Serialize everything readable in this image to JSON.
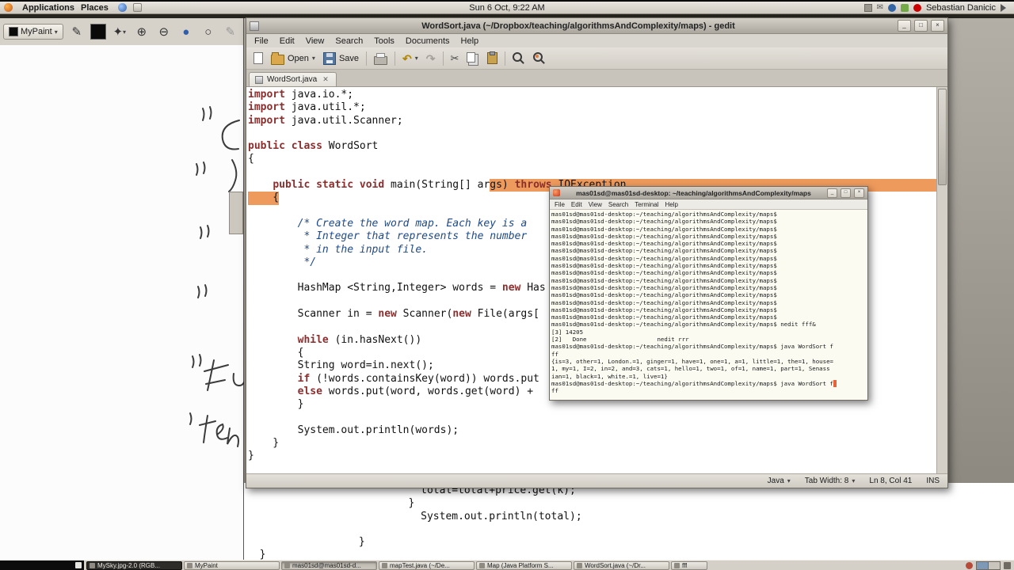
{
  "icons": {
    "caret": "▾",
    "close": "×",
    "min": "_",
    "max": "□",
    "tab_close": "✕",
    "scissors": "✂",
    "undo": "↶",
    "redo": "↷",
    "pencil": "✎",
    "star": "✦",
    "zoom_in": "⊕",
    "zoom_out": "⊖",
    "dot": "●",
    "ring": "○",
    "mail": "✉"
  },
  "top_panel": {
    "menus": [
      "Applications",
      "Places"
    ],
    "clock": "Sun 6 Oct, 9:22 AM",
    "user": "Sebastian Danicic"
  },
  "mypaint": {
    "app_label": "MyPaint"
  },
  "gedit": {
    "title": "WordSort.java (~/Dropbox/teaching/algorithmsAndComplexity/maps) - gedit",
    "menu": [
      "File",
      "Edit",
      "View",
      "Search",
      "Tools",
      "Documents",
      "Help"
    ],
    "toolbar": {
      "open": "Open",
      "save": "Save"
    },
    "tab": "WordSort.java",
    "status": {
      "language": "Java",
      "tab_width": "Tab Width: 8",
      "cursor": "Ln 8, Col 41",
      "mode": "INS"
    },
    "code_lines": [
      {
        "s": [
          [
            "k",
            "import"
          ],
          [
            "p",
            " java.io.*;"
          ]
        ]
      },
      {
        "s": [
          [
            "k",
            "import"
          ],
          [
            "p",
            " java.util.*;"
          ]
        ]
      },
      {
        "s": [
          [
            "k",
            "import"
          ],
          [
            "p",
            " java.util.Scanner;"
          ]
        ]
      },
      {},
      {
        "s": [
          [
            "k",
            "public"
          ],
          [
            "p",
            " "
          ],
          [
            "k",
            "class"
          ],
          [
            "p",
            " WordSort"
          ]
        ]
      },
      {
        "s": [
          [
            "p",
            "{"
          ]
        ]
      },
      {},
      {
        "s": [
          [
            "p",
            "    "
          ],
          [
            "k",
            "public"
          ],
          [
            "p",
            " "
          ],
          [
            "k",
            "static"
          ],
          [
            "p",
            " "
          ],
          [
            "k",
            "void"
          ],
          [
            "p",
            " main(String[] ar"
          ],
          [
            "p sel",
            "gs) "
          ],
          [
            "k sel",
            "throws"
          ],
          [
            "p sel",
            " IOException"
          ]
        ],
        "ext": true
      },
      {
        "s": [
          [
            "p sel",
            "    {"
          ]
        ]
      },
      {},
      {
        "s": [
          [
            "c",
            "        /* Create the word map. Each key is a"
          ]
        ]
      },
      {
        "s": [
          [
            "c",
            "         * Integer that represents the number"
          ]
        ]
      },
      {
        "s": [
          [
            "c",
            "         * in the input file."
          ]
        ]
      },
      {
        "s": [
          [
            "c",
            "         */"
          ]
        ]
      },
      {},
      {
        "s": [
          [
            "p",
            "        HashMap <String,Integer> words = "
          ],
          [
            "k",
            "new"
          ],
          [
            "p",
            " Has"
          ]
        ]
      },
      {},
      {
        "s": [
          [
            "p",
            "        Scanner in = "
          ],
          [
            "k",
            "new"
          ],
          [
            "p",
            " Scanner("
          ],
          [
            "k",
            "new"
          ],
          [
            "p",
            " File(args["
          ]
        ]
      },
      {},
      {
        "s": [
          [
            "p",
            "        "
          ],
          [
            "k",
            "while"
          ],
          [
            "p",
            " (in.hasNext())"
          ]
        ]
      },
      {
        "s": [
          [
            "p",
            "        {"
          ]
        ]
      },
      {
        "s": [
          [
            "p",
            "        String word=in.next();"
          ]
        ]
      },
      {
        "s": [
          [
            "p",
            "        "
          ],
          [
            "k",
            "if"
          ],
          [
            "p",
            " (!words.containsKey(word)) words.put"
          ]
        ]
      },
      {
        "s": [
          [
            "p",
            "        "
          ],
          [
            "k",
            "else"
          ],
          [
            "p",
            " words.put(word, words.get(word) + "
          ]
        ]
      },
      {
        "s": [
          [
            "p",
            "        }"
          ]
        ]
      },
      {},
      {
        "s": [
          [
            "p",
            "        System.out.println(words);"
          ]
        ]
      },
      {
        "s": [
          [
            "p",
            "    }"
          ]
        ]
      },
      {
        "s": [
          [
            "p",
            "}"
          ]
        ]
      }
    ]
  },
  "terminal": {
    "title": "mas01sd@mas01sd-desktop: ~/teaching/algorithmsAndComplexity/maps",
    "menu": [
      "File",
      "Edit",
      "View",
      "Search",
      "Terminal",
      "Help"
    ],
    "lines": [
      {
        "t": "mas01sd@mas01sd-desktop:~/teaching/algorithmsAndComplexity/maps$",
        "n": 15
      },
      {
        "t": "mas01sd@mas01sd-desktop:~/teaching/algorithmsAndComplexity/maps$ nedit fff&"
      },
      {
        "t": "[3] 14205"
      },
      {
        "t": "[2]   Done                    nedit rrr"
      },
      {
        "t": "mas01sd@mas01sd-desktop:~/teaching/algorithmsAndComplexity/maps$ java WordSort f"
      },
      {
        "t": "ff"
      },
      {
        "t": "{is=3, other=1, London.=1, ginger=1, have=1, one=1, a=1, little=1, the=1, house="
      },
      {
        "t": "1, my=1, I=2, in=2, and=3, cats=1, hello=1, two=1, of=1, name=1, part=1, Senass"
      },
      {
        "t": "ian=1, black=1, white.=1, live=1}"
      },
      {
        "t": "mas01sd@mas01sd-desktop:~/teaching/algorithmsAndComplexity/maps$ java WordSort f",
        "cur": true
      },
      {
        "t": "ff"
      }
    ]
  },
  "background_editor": {
    "lines": [
      "                            total=total+price.get(k);",
      "                          }",
      "                            System.out.println(total);",
      "",
      "                  }",
      "  }"
    ]
  },
  "taskbar": {
    "items": [
      {
        "label": "MySky.jpg-2.0 (RGB...",
        "dark": true
      },
      {
        "label": "MyPaint"
      },
      {
        "label": "mas01sd@mas01sd-d...",
        "active": true
      },
      {
        "label": "mapTest.java (~/De..."
      },
      {
        "label": "Map (Java Platform S..."
      },
      {
        "label": "WordSort.java (~/Dr..."
      },
      {
        "label": "fff"
      }
    ]
  }
}
